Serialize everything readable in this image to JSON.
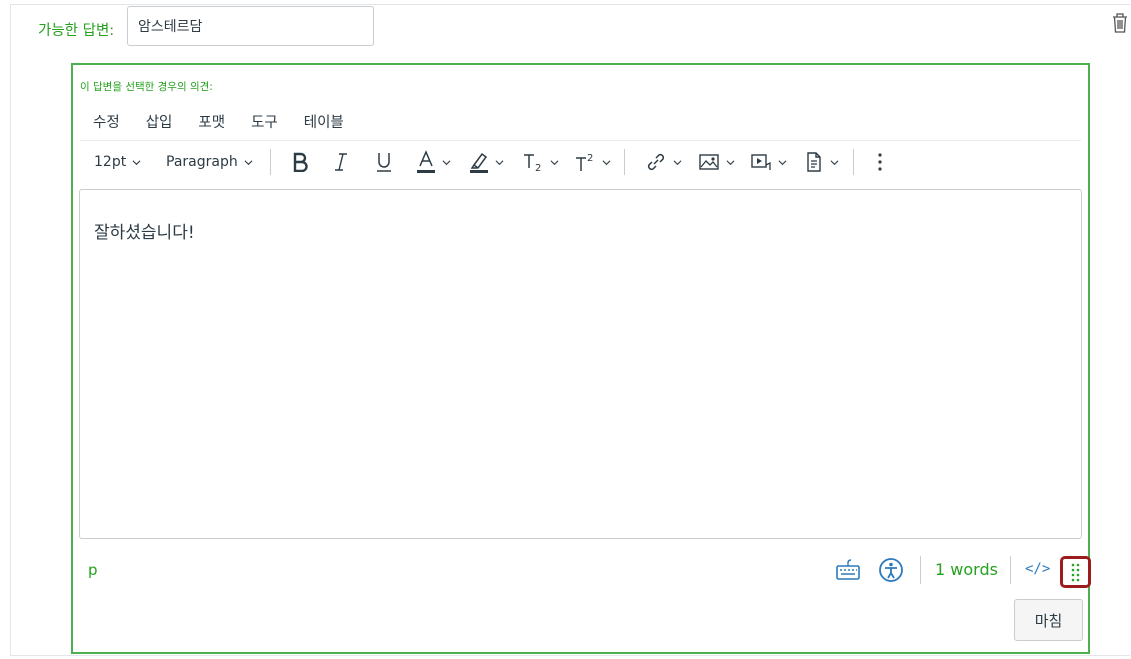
{
  "answer": {
    "label": "가능한 답변:",
    "value": "암스테르담"
  },
  "comment": {
    "label": "이 답변을 선택한 경우의 의견:"
  },
  "menubar": {
    "items": [
      "수정",
      "삽입",
      "포맷",
      "도구",
      "테이블"
    ]
  },
  "toolbar": {
    "font_size": "12pt",
    "block_format": "Paragraph"
  },
  "editor": {
    "content": "잘하셨습니다!"
  },
  "statusbar": {
    "element_path": "p",
    "word_count": "1 words",
    "html_toggle": "</>"
  },
  "actions": {
    "done_label": "마침"
  },
  "colors": {
    "accent_green": "#25a11f",
    "border_green": "#4caf50",
    "link_blue": "#2b7abc",
    "focus_red": "#9b1c1c"
  },
  "icons": [
    "trash-icon",
    "bold-icon",
    "italic-icon",
    "underline-icon",
    "text-color-icon",
    "highlight-icon",
    "subscript-icon",
    "superscript-icon",
    "link-icon",
    "image-icon",
    "media-icon",
    "document-icon",
    "more-icon",
    "keyboard-icon",
    "accessibility-icon",
    "resize-grip-icon"
  ]
}
